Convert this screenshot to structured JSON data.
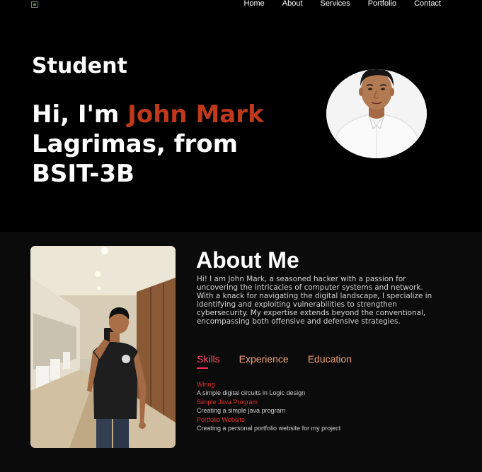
{
  "nav": {
    "items": [
      "Home",
      "About",
      "Services",
      "Portfolio",
      "Contact"
    ]
  },
  "hero": {
    "subtitle": "Student",
    "greeting": "Hi, I'm ",
    "name": "John Mark",
    "rest": " Lagrimas, from BSIT-3B"
  },
  "about": {
    "title": "About Me",
    "text": "Hi! I am John Mark, a seasoned hacker with a passion for uncovering the intricacies of computer systems and network. With a knack for navigating the digital landscape, I specialize in identifying and exploiting vulnerabilities to strengthen cybersecurity. My expertise extends beyond the conventional, encompassing both offensive and defensive strategies.",
    "tabs": [
      "Skills",
      "Experience",
      "Education"
    ],
    "skills": [
      {
        "name": "Wiring",
        "desc": "A simple digital circuits in Logic design"
      },
      {
        "name": "Simple Java Program",
        "desc": "Creating a simple java program"
      },
      {
        "name": "Portfolio Website",
        "desc": "Creating a personal portfolio website for my project"
      }
    ]
  },
  "colors": {
    "accent": "#c0391b",
    "tab_active": "#ff4b6c",
    "tab_inactive": "#f0a07a",
    "skill_name": "#e03030"
  }
}
